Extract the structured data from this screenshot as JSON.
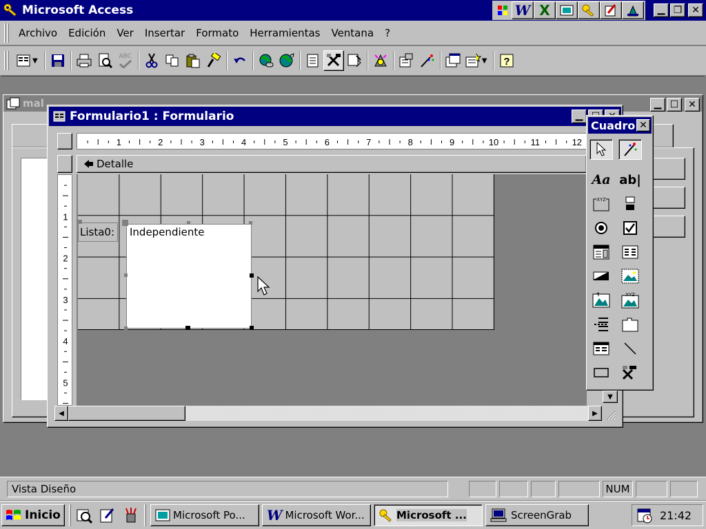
{
  "app": {
    "title": "Microsoft Access"
  },
  "menu": {
    "items": [
      "Archivo",
      "Edición",
      "Ver",
      "Insertar",
      "Formato",
      "Herramientas",
      "Ventana",
      "?"
    ]
  },
  "db_window": {
    "title": "mal"
  },
  "form_window": {
    "title": "Formulario1 : Formulario",
    "section": "Detalle",
    "ruler_numbers": [
      "1",
      "2",
      "3",
      "4",
      "5",
      "6",
      "7",
      "8",
      "9",
      "10",
      "11",
      "12"
    ],
    "vruler_numbers": [
      "1",
      "2",
      "3",
      "4",
      "5"
    ],
    "list_label": "Lista0:",
    "list_value": "Independiente"
  },
  "toolbox": {
    "title": "Cuadro"
  },
  "status": {
    "text": "Vista Diseño",
    "num": "NUM"
  },
  "taskbar": {
    "start": "Inicio",
    "tasks": [
      "Microsoft Po...",
      "Microsoft Wor...",
      "Microsoft ...",
      "ScreenGrab"
    ],
    "clock": "21:42"
  },
  "colors": {
    "titlebar": "#000080",
    "face": "#c0c0c0",
    "desktop": "#808080",
    "grid_bg": "#c0c0c0"
  }
}
